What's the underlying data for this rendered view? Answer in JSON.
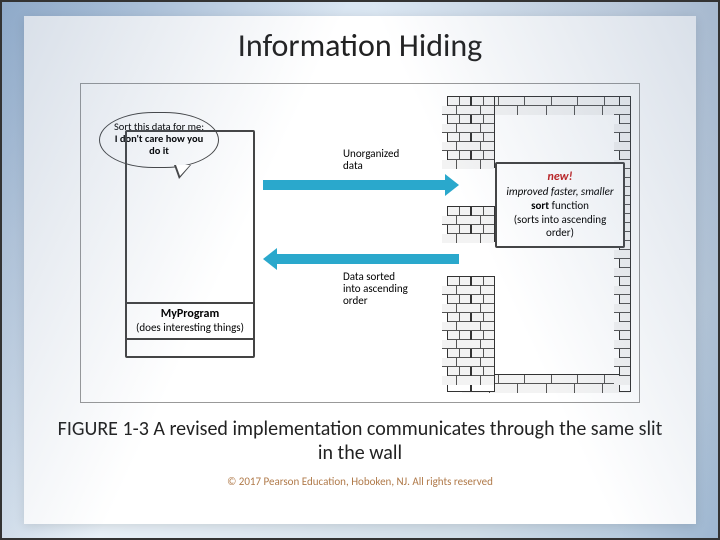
{
  "title": "Information Hiding",
  "caption": "FIGURE 1-3 A revised implementation communicates through the same slit in the wall",
  "copyright": "© 2017 Pearson Education, Hoboken, NJ.  All rights reserved",
  "bubble": {
    "line1": "Sort this data for me;",
    "line2_bold": "I don't care how you",
    "line3_bold": "do it"
  },
  "program": {
    "name": "MyProgram",
    "desc": "(does interesting things)"
  },
  "arrows": {
    "top_line1": "Unorganized",
    "top_line2": "data",
    "bottom_line1": "Data sorted",
    "bottom_line2": "into ascending",
    "bottom_line3": "order"
  },
  "sortbox": {
    "new": "new!",
    "line2": "improved faster, smaller",
    "sort_word": "sort",
    "function_word": "function",
    "line4": "(sorts into ascending order)"
  }
}
